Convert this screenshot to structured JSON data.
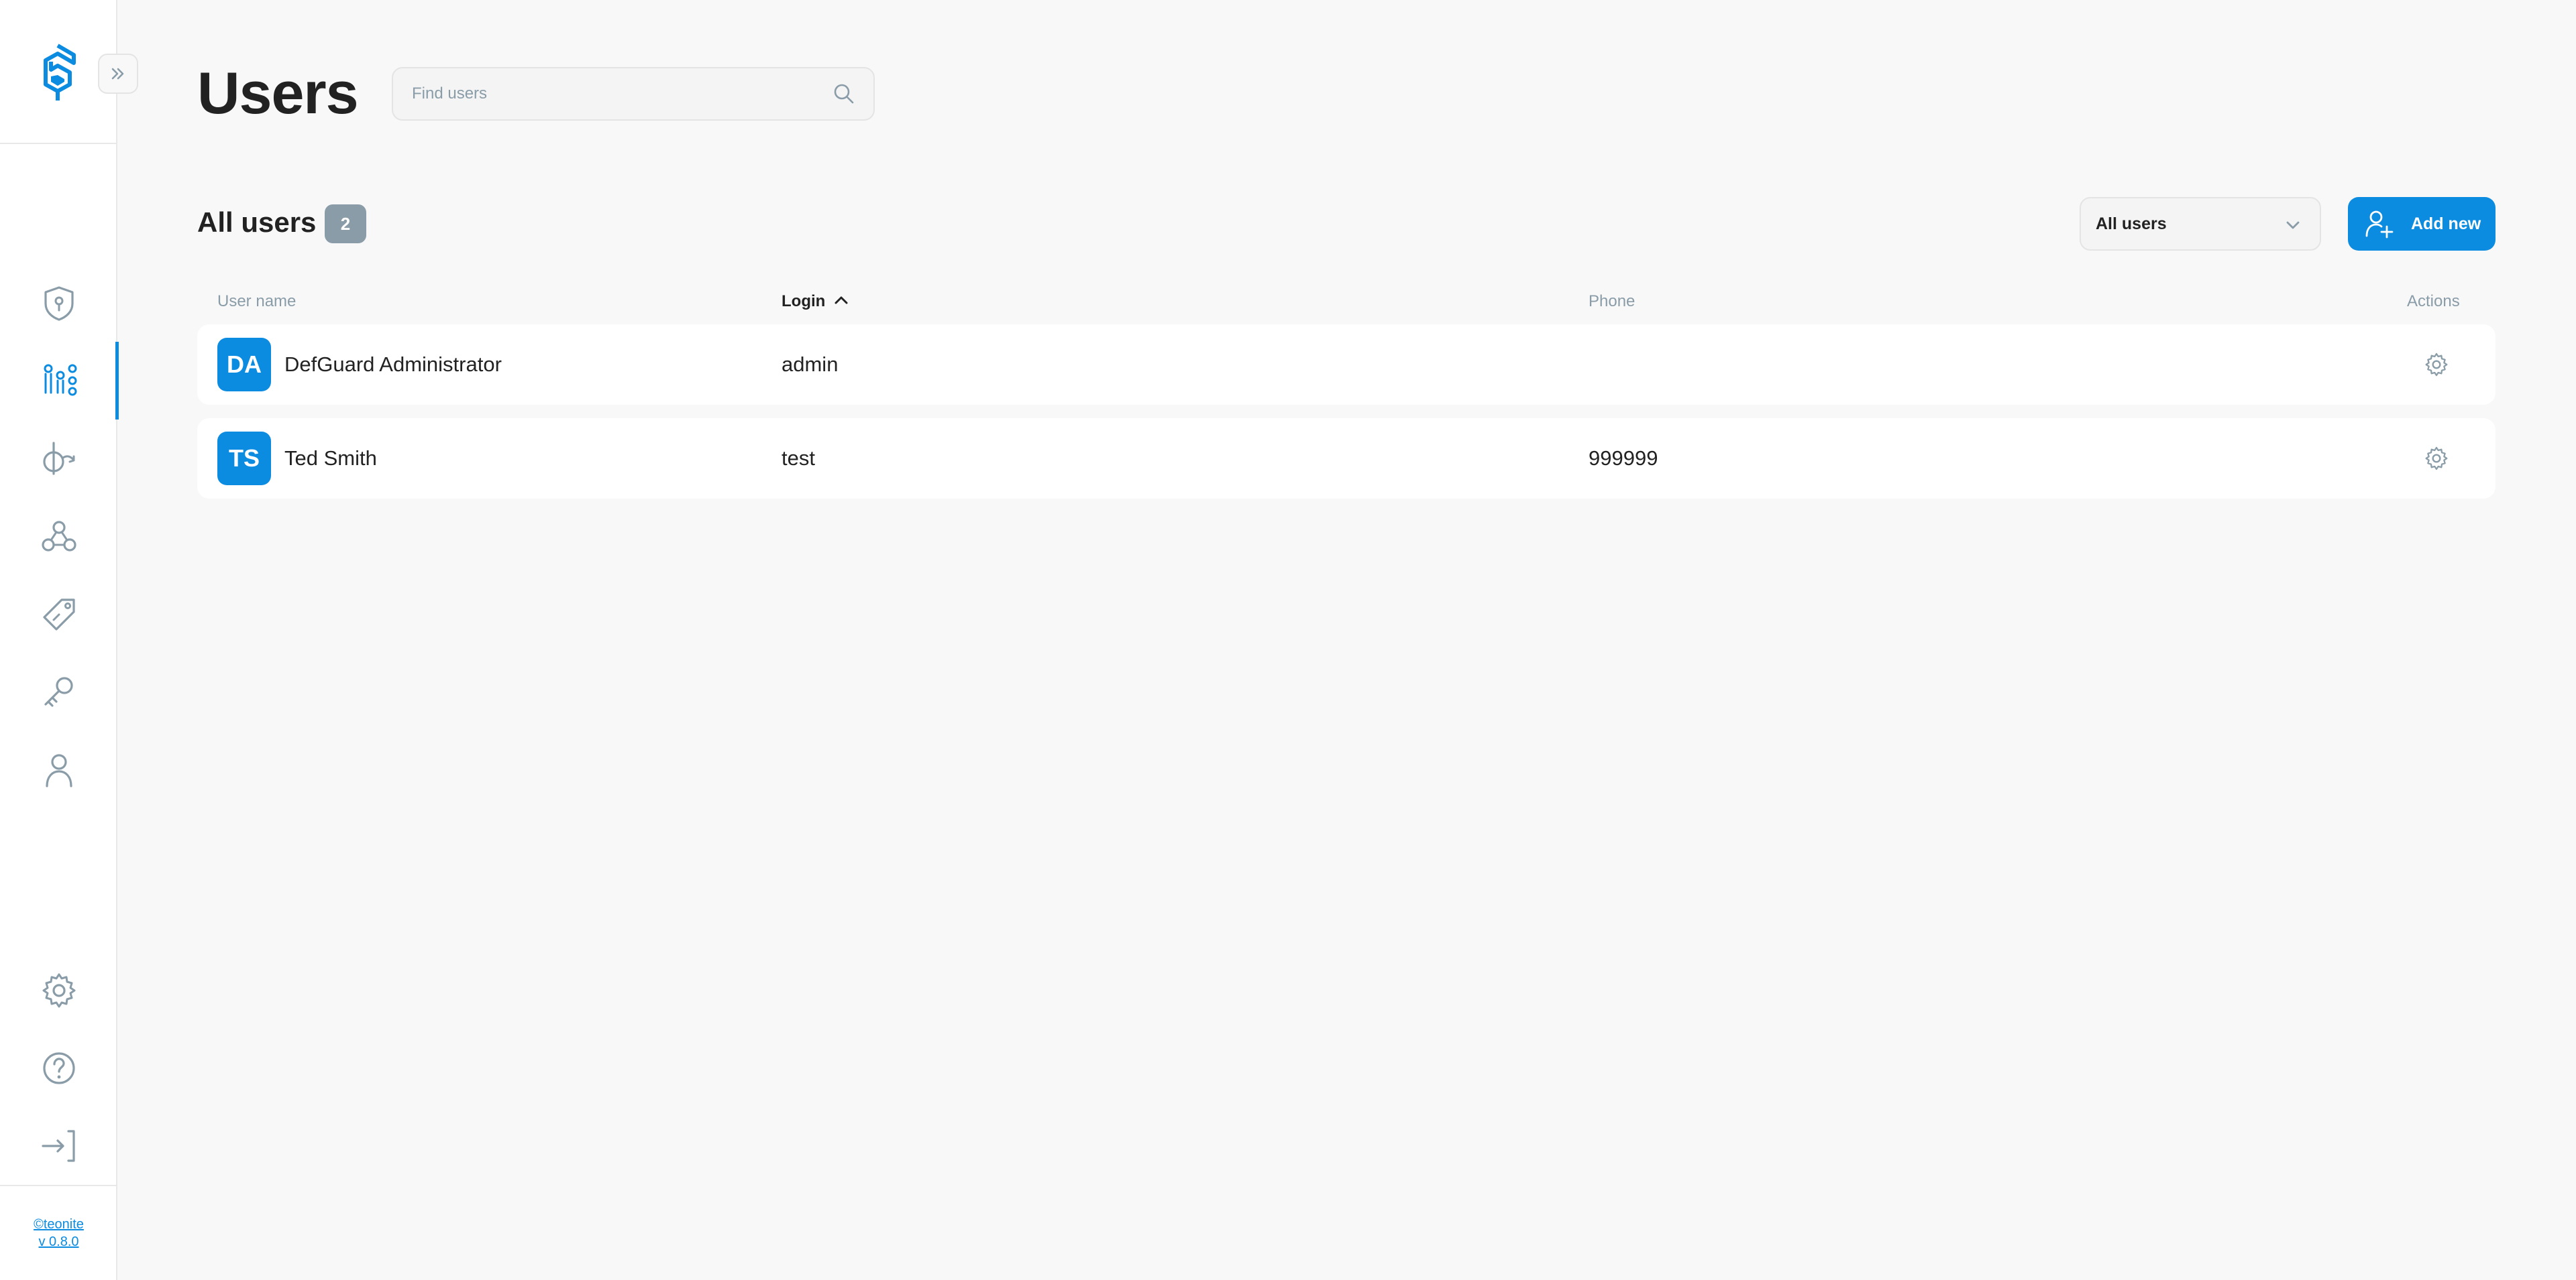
{
  "sidebar": {
    "footer": {
      "copyright": "©teonite",
      "version": "v 0.8.0"
    },
    "items": [
      {
        "icon": "shield-icon"
      },
      {
        "icon": "users-icon",
        "active": true
      },
      {
        "icon": "openid-icon"
      },
      {
        "icon": "webhooks-icon"
      },
      {
        "icon": "tag-icon"
      },
      {
        "icon": "key-icon"
      },
      {
        "icon": "profile-icon"
      },
      {
        "icon": "gear-icon"
      },
      {
        "icon": "help-icon"
      },
      {
        "icon": "logout-icon"
      }
    ]
  },
  "header": {
    "title": "Users",
    "search_placeholder": "Find users"
  },
  "section": {
    "title": "All users",
    "count": "2",
    "filter_value": "All users",
    "add_label": "Add new"
  },
  "table": {
    "columns": [
      "User name",
      "Login",
      "Phone",
      "Actions"
    ],
    "sorted_column": "Login",
    "rows": [
      {
        "initials": "DA",
        "name": "DefGuard Administrator",
        "login": "admin",
        "phone": ""
      },
      {
        "initials": "TS",
        "name": "Ted Smith",
        "login": "test",
        "phone": "999999"
      }
    ]
  },
  "colors": {
    "accent": "#0c8ce0",
    "muted": "#899ca8",
    "background": "#f8f8f8"
  }
}
